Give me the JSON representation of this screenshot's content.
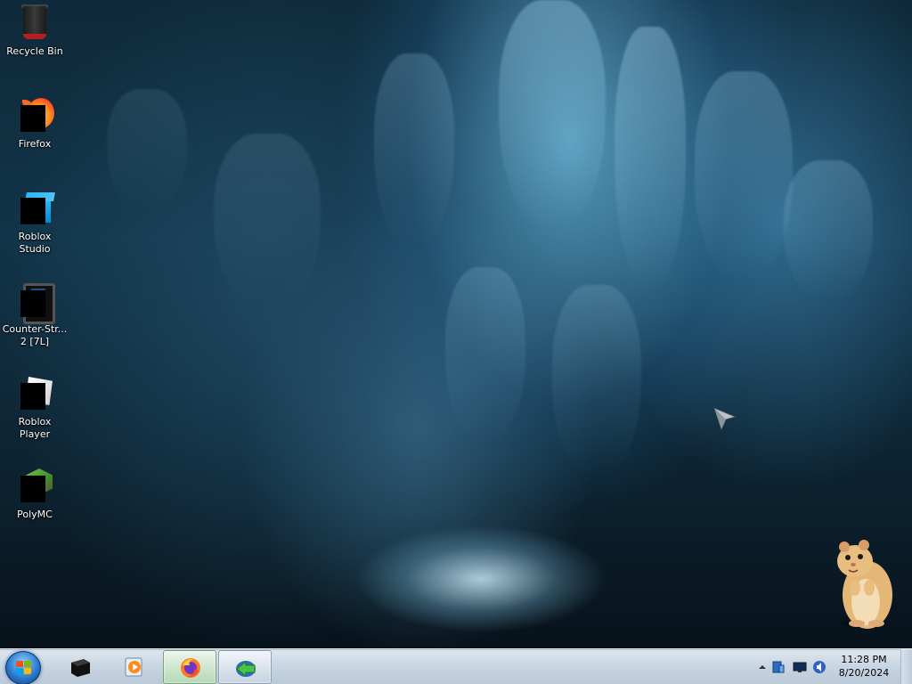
{
  "desktop": {
    "icons": [
      {
        "label": "Recycle Bin",
        "icon": "recycle-bin-icon"
      },
      {
        "label": "Firefox",
        "icon": "firefox-icon"
      },
      {
        "label": "Roblox Studio",
        "icon": "roblox-studio-icon"
      },
      {
        "label": "Counter-Str... 2 [7L]",
        "icon": "counter-strike-icon"
      },
      {
        "label": "Roblox Player",
        "icon": "roblox-player-icon"
      },
      {
        "label": "PolyMC",
        "icon": "polymc-icon"
      }
    ],
    "wallpaper": "ice-cave"
  },
  "taskbar": {
    "start_icon": "windows-start-orb-icon",
    "pinned": [
      {
        "icon": "black-window-icon",
        "state": "pinned"
      },
      {
        "icon": "media-player-icon",
        "state": "pinned"
      },
      {
        "icon": "firefox-icon",
        "state": "active"
      },
      {
        "icon": "green-arrow-app-icon",
        "state": "open"
      }
    ],
    "tray": {
      "icons": [
        "show-hidden-icons-chevron",
        "network-adapter-icon",
        "display-monitor-icon",
        "volume-icon"
      ],
      "time": "11:28 PM",
      "date": "8/20/2024"
    }
  },
  "colors": {
    "taskbar_top": "#dfe7ef",
    "taskbar_bottom": "#b9c8d8",
    "active_button": "#cfe6cf",
    "ice_blue": "#4fa6d8"
  }
}
